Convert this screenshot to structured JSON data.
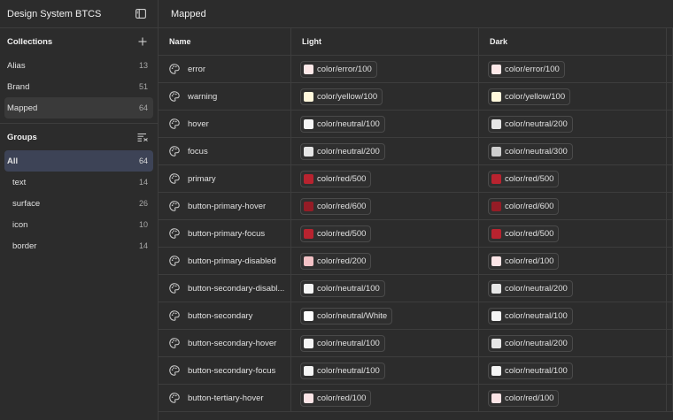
{
  "sidebar": {
    "title": "Design System BTCS",
    "collections_heading": "Collections",
    "collections": [
      {
        "label": "Alias",
        "count": "13"
      },
      {
        "label": "Brand",
        "count": "51"
      },
      {
        "label": "Mapped",
        "count": "64"
      }
    ],
    "groups_heading": "Groups",
    "groups": [
      {
        "label": "All",
        "count": "64"
      },
      {
        "label": "text",
        "count": "14"
      },
      {
        "label": "surface",
        "count": "26"
      },
      {
        "label": "icon",
        "count": "10"
      },
      {
        "label": "border",
        "count": "14"
      }
    ]
  },
  "main": {
    "title": "Mapped",
    "columns": {
      "name": "Name",
      "light": "Light",
      "dark": "Dark"
    },
    "rows": [
      {
        "name": "error",
        "light": {
          "label": "color/error/100",
          "color": "#fde8e8"
        },
        "dark": {
          "label": "color/error/100",
          "color": "#fde8e8"
        }
      },
      {
        "name": "warning",
        "light": {
          "label": "color/yellow/100",
          "color": "#fff8dc"
        },
        "dark": {
          "label": "color/yellow/100",
          "color": "#fff8dc"
        }
      },
      {
        "name": "hover",
        "light": {
          "label": "color/neutral/100",
          "color": "#f5f5f5"
        },
        "dark": {
          "label": "color/neutral/200",
          "color": "#e6e6e6"
        }
      },
      {
        "name": "focus",
        "light": {
          "label": "color/neutral/200",
          "color": "#e6e6e6"
        },
        "dark": {
          "label": "color/neutral/300",
          "color": "#cfcfcf"
        }
      },
      {
        "name": "primary",
        "light": {
          "label": "color/red/500",
          "color": "#b8232f"
        },
        "dark": {
          "label": "color/red/500",
          "color": "#b8232f"
        }
      },
      {
        "name": "button-primary-hover",
        "light": {
          "label": "color/red/600",
          "color": "#951c26"
        },
        "dark": {
          "label": "color/red/600",
          "color": "#951c26"
        }
      },
      {
        "name": "button-primary-focus",
        "light": {
          "label": "color/red/500",
          "color": "#b8232f"
        },
        "dark": {
          "label": "color/red/500",
          "color": "#b8232f"
        }
      },
      {
        "name": "button-primary-disabled",
        "light": {
          "label": "color/red/200",
          "color": "#f3c2c6"
        },
        "dark": {
          "label": "color/red/100",
          "color": "#fbe4e6"
        }
      },
      {
        "name": "button-secondary-disabl...",
        "light": {
          "label": "color/neutral/100",
          "color": "#f5f5f5"
        },
        "dark": {
          "label": "color/neutral/200",
          "color": "#e6e6e6"
        }
      },
      {
        "name": "button-secondary",
        "light": {
          "label": "color/neutral/White",
          "color": "#ffffff"
        },
        "dark": {
          "label": "color/neutral/100",
          "color": "#f5f5f5"
        }
      },
      {
        "name": "button-secondary-hover",
        "light": {
          "label": "color/neutral/100",
          "color": "#f5f5f5"
        },
        "dark": {
          "label": "color/neutral/200",
          "color": "#e6e6e6"
        }
      },
      {
        "name": "button-secondary-focus",
        "light": {
          "label": "color/neutral/100",
          "color": "#f5f5f5"
        },
        "dark": {
          "label": "color/neutral/100",
          "color": "#f5f5f5"
        }
      },
      {
        "name": "button-tertiary-hover",
        "light": {
          "label": "color/red/100",
          "color": "#fbe4e6"
        },
        "dark": {
          "label": "color/red/100",
          "color": "#fbe4e6"
        }
      }
    ]
  },
  "icons": {
    "sidebar_toggle": "sidebar-toggle-icon",
    "add_collection": "plus-icon",
    "group_sort": "list-filter-icon",
    "variable": "palette-icon"
  }
}
